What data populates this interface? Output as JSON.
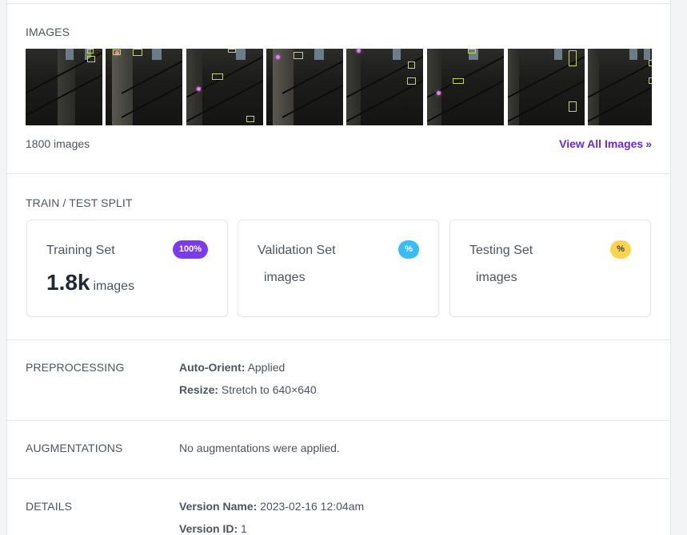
{
  "images": {
    "section_title": "IMAGES",
    "count_text": "1800 images",
    "view_all_label": "View All Images",
    "view_all_icon": "double-chevron-right-icon",
    "view_all_chevron": "»"
  },
  "split": {
    "section_title": "TRAIN / TEST SPLIT",
    "cards": [
      {
        "label": "Training Set",
        "badge": "100%",
        "value": "1.8k",
        "unit": "images",
        "badge_color": "#7c3aed"
      },
      {
        "label": "Validation Set",
        "badge": "%",
        "value": "",
        "unit": "images",
        "badge_color": "#38bdf8"
      },
      {
        "label": "Testing Set",
        "badge": "%",
        "value": "",
        "unit": "images",
        "badge_color": "#fcd34d"
      }
    ]
  },
  "preprocessing": {
    "section_title": "PREPROCESSING",
    "items": [
      {
        "key": "Auto-Orient:",
        "value": "Applied"
      },
      {
        "key": "Resize:",
        "value": "Stretch to 640×640"
      }
    ]
  },
  "augmentations": {
    "section_title": "AUGMENTATIONS",
    "text": "No augmentations were applied."
  },
  "details": {
    "section_title": "DETAILS",
    "items": [
      {
        "key": "Version Name:",
        "value": "2023-02-16 12:04am"
      },
      {
        "key": "Version ID:",
        "value": "1"
      }
    ]
  },
  "colors": {
    "accent": "#6d28d9",
    "bbox": "#c8d64a",
    "keypoint": "#e879f9"
  }
}
